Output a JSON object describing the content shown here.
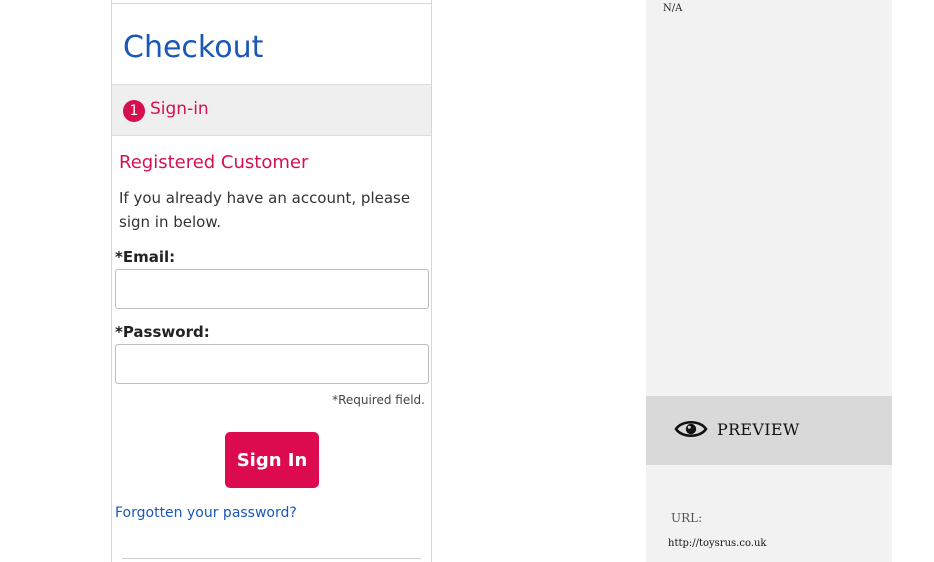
{
  "checkout": {
    "title": "Checkout",
    "step": {
      "number": "1",
      "label": "Sign-in"
    },
    "section_title": "Registered Customer",
    "intro": "If you already have an account, please sign in below.",
    "email_label": "*Email:",
    "password_label": "*Password:",
    "email_value": "",
    "password_value": "",
    "required_note": "*Required field.",
    "sign_in_label": "Sign In",
    "forgot_link": "Forgotten your password?"
  },
  "panel": {
    "na_text": "N/A",
    "preview_label": "PREVIEW",
    "preview_icon": "eye-icon",
    "url_label": "URL:",
    "url_value": "http://toysrus.co.uk"
  },
  "colors": {
    "brand_pink": "#d6104f",
    "link_blue": "#1a57b8",
    "panel_bg": "#f2f2f2",
    "preview_bar": "#d9d9d9"
  }
}
